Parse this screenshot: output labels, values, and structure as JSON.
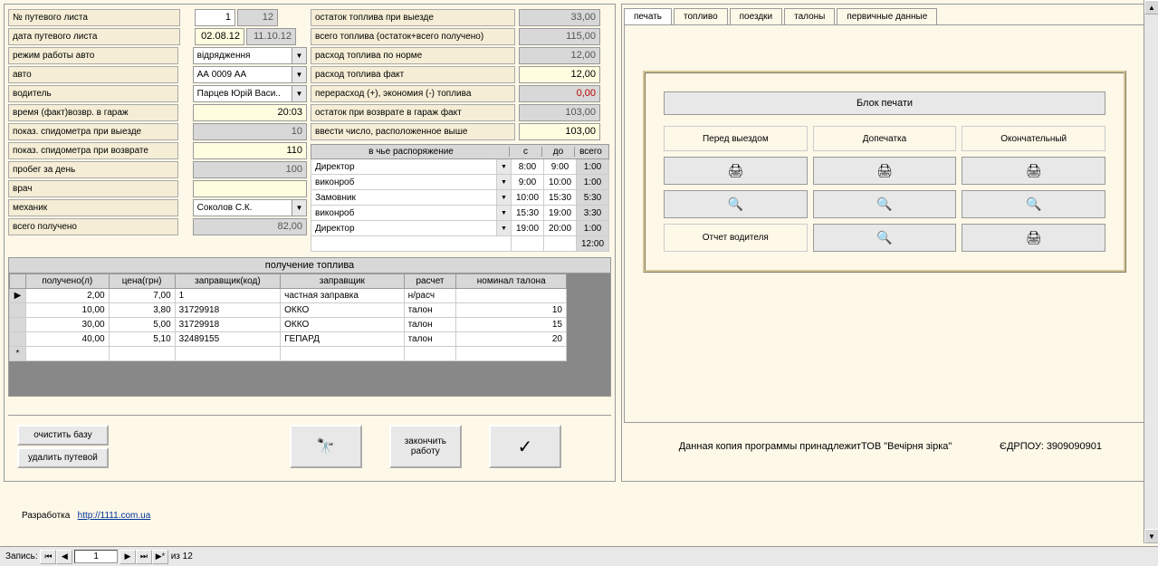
{
  "left": {
    "labels": {
      "sheet_no": "№ путевого листа",
      "sheet_date": "дата путевого листа",
      "work_mode": "режим работы авто",
      "auto": "авто",
      "driver": "водитель",
      "return_time": "время (факт)возвр. в гараж",
      "odo_out": "показ. спидометра при выезде",
      "odo_in": "показ. спидометра при возврате",
      "mileage": "пробег за день",
      "doctor": "врач",
      "mechanic": "механик",
      "total_received": "всего получено"
    },
    "values": {
      "sheet_no": "1",
      "sheet_no2": "12",
      "date1": "02.08.12",
      "date2": "11.10.12",
      "work_mode": "відрядження",
      "auto": "АА 0009 АА",
      "driver": "Парцев Юрій Васи..",
      "return_time": "20:03",
      "odo_out": "10",
      "odo_in": "110",
      "mileage": "100",
      "doctor": "",
      "mechanic": "Соколов С.К.",
      "total_received": "82,00"
    }
  },
  "rightcalc": {
    "labels": {
      "fuel_out": "остаток топлива при выезде",
      "fuel_total": "всего топлива (остаток+всего получено)",
      "fuel_norm": "расход топлива по норме",
      "fuel_fact": "расход топлива факт",
      "overrun": "перерасход (+), экономия (-) топлива",
      "return_fact": "остаток при возврате в гараж  факт",
      "enter_above": "ввести число, расположенное выше"
    },
    "values": {
      "fuel_out": "33,00",
      "fuel_total": "115,00",
      "fuel_norm": "12,00",
      "fuel_fact": "12,00",
      "overrun": "0,00",
      "return_fact": "103,00",
      "enter_above": "103,00"
    }
  },
  "disposal": {
    "title": "в чье распоряжение",
    "cols": {
      "from": "с",
      "to": "до",
      "total": "всего"
    },
    "rows": [
      {
        "name": "Директор",
        "from": "8:00",
        "to": "9:00",
        "total": "1:00"
      },
      {
        "name": "виконроб",
        "from": "9:00",
        "to": "10:00",
        "total": "1:00"
      },
      {
        "name": "Замовник",
        "from": "10:00",
        "to": "15:30",
        "total": "5:30"
      },
      {
        "name": "виконроб",
        "from": "15:30",
        "to": "19:00",
        "total": "3:30"
      },
      {
        "name": "Директор",
        "from": "19:00",
        "to": "20:00",
        "total": "1:00"
      }
    ],
    "grand_total": "12:00"
  },
  "fuel": {
    "title": "получение топлива",
    "cols": {
      "received": "получено(л)",
      "price": "цена(грн)",
      "filler_code": "заправщик(код)",
      "filler": "заправщик",
      "payment": "расчет",
      "coupon": "номинал талона"
    },
    "rows": [
      {
        "received": "2,00",
        "price": "7,00",
        "code": "1",
        "filler": "частная заправка",
        "payment": "н/расч",
        "coupon": ""
      },
      {
        "received": "10,00",
        "price": "3,80",
        "code": "31729918",
        "filler": "ОККО",
        "payment": "талон",
        "coupon": "10"
      },
      {
        "received": "30,00",
        "price": "5,00",
        "code": "31729918",
        "filler": "ОККО",
        "payment": "талон",
        "coupon": "15"
      },
      {
        "received": "40,00",
        "price": "5,10",
        "code": "32489155",
        "filler": "ГЕПАРД",
        "payment": "талон",
        "coupon": "20"
      }
    ]
  },
  "buttons": {
    "clear_db": "очистить базу",
    "delete_sheet": "удалить путевой",
    "finish": "закончить\nработу"
  },
  "tabs": [
    "печать",
    "топливо",
    "поездки",
    "талоны",
    "первичные данные"
  ],
  "print": {
    "title": "Блок печати",
    "headers": [
      "Перед выездом",
      "Допечатка",
      "Окончательный"
    ],
    "driver_report": "Отчет водителя"
  },
  "footer": {
    "dev": "Разработка",
    "link": "http://1111.com.ua",
    "copy": "Данная копия программы принадлежитТОВ \"Вечірня зірка\"",
    "edrpou_label": "ЄДРПОУ:",
    "edrpou": "3909090901"
  },
  "status": {
    "record": "Запись:",
    "current": "1",
    "of": "из  12"
  }
}
